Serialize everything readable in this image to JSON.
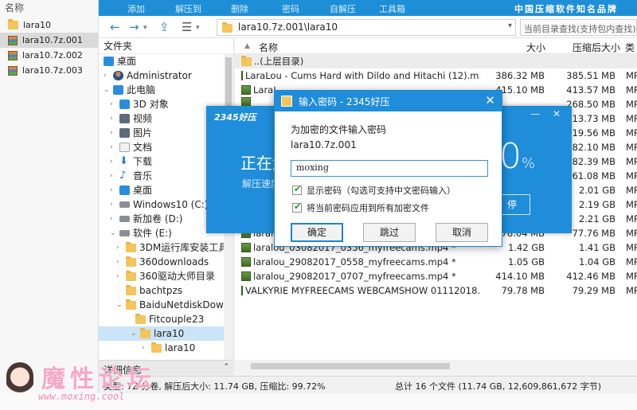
{
  "left_panel": {
    "header": "名称",
    "items": [
      {
        "label": "lara10",
        "icon": "folder-icon"
      },
      {
        "label": "lara10.7z.001",
        "icon": "archive-icon",
        "selected": true
      },
      {
        "label": "lara10.7z.002",
        "icon": "archive-icon"
      },
      {
        "label": "lara10.7z.003",
        "icon": "archive-icon"
      }
    ]
  },
  "toolbar": {
    "items": [
      "添加",
      "解压到",
      "删除",
      "密码",
      "自解压",
      "工具箱"
    ],
    "brand": "中国压缩软件知名品牌"
  },
  "nav": {
    "path": "lara10.7z.001\\lara10",
    "search_placeholder": "当前目录查找(支持包内查找)"
  },
  "tree": {
    "header": "文件夹",
    "items": [
      {
        "label": "桌面",
        "icon": "desktop-icon",
        "arrow": ""
      },
      {
        "label": "Administrator",
        "icon": "user-icon",
        "arrow": "›"
      },
      {
        "label": "此电脑",
        "icon": "computer-icon",
        "arrow": "⌄"
      },
      {
        "label": "3D 对象",
        "icon": "3d-objects-icon",
        "arrow": "›"
      },
      {
        "label": "视频",
        "icon": "video-icon",
        "arrow": "›"
      },
      {
        "label": "图片",
        "icon": "picture-icon",
        "arrow": "›"
      },
      {
        "label": "文档",
        "icon": "document-icon",
        "arrow": "›"
      },
      {
        "label": "下载",
        "icon": "download-icon",
        "arrow": "›"
      },
      {
        "label": "音乐",
        "icon": "music-icon",
        "arrow": "›"
      },
      {
        "label": "桌面",
        "icon": "desktop-icon",
        "arrow": "›"
      },
      {
        "label": "Windows10 (C:)",
        "icon": "drive-icon",
        "arrow": "›"
      },
      {
        "label": "新加卷 (D:)",
        "icon": "drive-icon",
        "arrow": "›"
      },
      {
        "label": "软件 (E:)",
        "icon": "drive-icon",
        "arrow": "⌄"
      },
      {
        "label": "3DM运行库安装工具",
        "icon": "folder-icon",
        "arrow": "›"
      },
      {
        "label": "360downloads",
        "icon": "folder-icon",
        "arrow": "›"
      },
      {
        "label": "360驱动大师目录",
        "icon": "folder-icon",
        "arrow": "›"
      },
      {
        "label": "bachtpzs",
        "icon": "folder-icon",
        "arrow": ""
      },
      {
        "label": "BaiduNetdiskDownl",
        "icon": "folder-icon",
        "arrow": "⌄"
      },
      {
        "label": "Fitcouple23",
        "icon": "folder-icon",
        "arrow": ""
      },
      {
        "label": "lara10",
        "icon": "folder-icon",
        "arrow": "⌄",
        "selected": true
      },
      {
        "label": "lara10",
        "icon": "folder-icon",
        "arrow": "›"
      }
    ]
  },
  "list": {
    "headers": {
      "name": "名称",
      "size": "大小",
      "packed": "压缩后大小",
      "type": "类型"
    },
    "sort_indicator": "▲",
    "rows": [
      {
        "name": "..(上层目录)",
        "size": "",
        "packed": "",
        "type": "",
        "up": true
      },
      {
        "name": "LaraLou - Cums Hard with Dildo and Hitachi (12).m...",
        "size": "386.32 MB",
        "packed": "385.51 MB",
        "type": "MP4"
      },
      {
        "name": "LaraL",
        "size": "415.10 MB",
        "packed": "413.57 MB",
        "type": "MP4"
      },
      {
        "name": "",
        "size": "",
        "packed": "268.50 MB",
        "type": "MP4"
      },
      {
        "name": "",
        "size": "",
        "packed": "413.73 MB",
        "type": "MP4"
      },
      {
        "name": "",
        "size": "",
        "packed": "419.56 MB",
        "type": "MP4"
      },
      {
        "name": "",
        "size": "",
        "packed": "282.10 MB",
        "type": "MP4"
      },
      {
        "name": "",
        "size": "",
        "packed": "82.39 MB",
        "type": "MP4"
      },
      {
        "name": "",
        "size": "",
        "packed": "61.08 MB",
        "type": "MP4"
      },
      {
        "name": "",
        "size": "",
        "packed": "2.01 GB",
        "type": "MP4"
      },
      {
        "name": "",
        "size": "",
        "packed": "2.19 GB",
        "type": "MP4"
      },
      {
        "name": "",
        "size": "",
        "packed": "2.21 GB",
        "type": "MP4"
      },
      {
        "name": "laralc",
        "size": "78.04 MB",
        "packed": "77.76 MB",
        "type": "MP4"
      },
      {
        "name": "laralou_03082017_0356_myfreecams.mp4 *",
        "size": "1.42 GB",
        "packed": "1.41 GB",
        "type": "MP4"
      },
      {
        "name": "laralou_29082017_0558_myfreecams.mp4 *",
        "size": "1.05 GB",
        "packed": "1.04 GB",
        "type": "MP4"
      },
      {
        "name": "laralou_29082017_0707_myfreecams.mp4 *",
        "size": "414.10 MB",
        "packed": "412.46 MB",
        "type": "MP4"
      },
      {
        "name": "VALKYRIE MYFREECAMS WEBCAMSHOW 01112018...",
        "size": "79.78 MB",
        "packed": "79.29 MB",
        "type": "MP4"
      }
    ]
  },
  "detail": {
    "label": "详细信息"
  },
  "status": {
    "left": "类型: 7Z 分卷, 解压后大小: 11.74 GB, 压缩比: 99.72%",
    "right": "总计 16 个文件 (11.74 GB, 12,609,861,672 字节)"
  },
  "progress": {
    "logo": "2345好压",
    "title": "正在解",
    "speed": "解压速度",
    "percent": "0",
    "percent_sign": "%",
    "button": "停",
    "win_controls": "—  ✕"
  },
  "dialog": {
    "title": "输入密码 - 2345好压",
    "close": "✕",
    "prompt": "为加密的文件输入密码",
    "filename": "lara10.7z.001",
    "password_value": "moxing",
    "show_password_label": "显示密码（勾选可支持中文密码输入）",
    "apply_all_label": "将当前密码应用到所有加密文件",
    "ok_label": "确定",
    "skip_label": "跳过",
    "cancel_label": "取消"
  },
  "watermark": {
    "cn": "魔性论坛",
    "en": "www.moxing.cool"
  }
}
